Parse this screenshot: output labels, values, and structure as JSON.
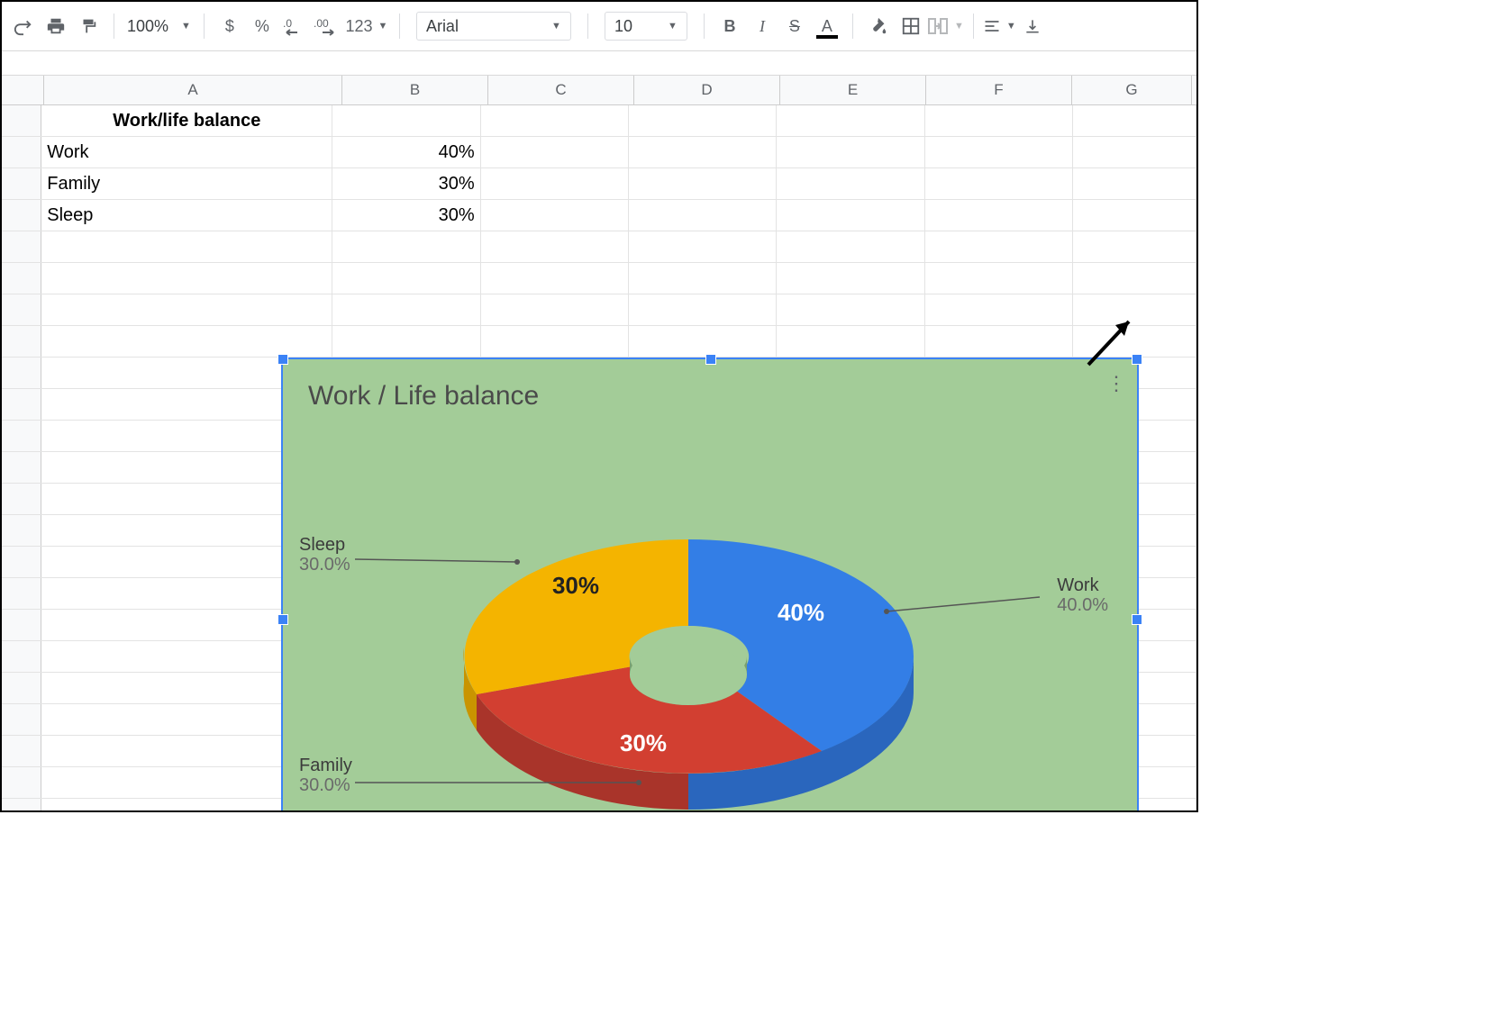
{
  "toolbar": {
    "zoom": "100%",
    "font": "Arial",
    "size": "10",
    "format123": "123"
  },
  "columns": [
    "A",
    "B",
    "C",
    "D",
    "E",
    "F",
    "G"
  ],
  "cells": {
    "a1": "Work/life balance",
    "a2": "Work",
    "b2": "40%",
    "a3": "Family",
    "b3": "30%",
    "a4": "Sleep",
    "b4": "30%"
  },
  "chart": {
    "title": "Work / Life balance",
    "labels": {
      "work": {
        "name": "Work",
        "pct": "40.0%",
        "slice": "40%"
      },
      "family": {
        "name": "Family",
        "pct": "30.0%",
        "slice": "30%"
      },
      "sleep": {
        "name": "Sleep",
        "pct": "30.0%",
        "slice": "30%"
      }
    }
  },
  "chart_data": {
    "type": "pie",
    "title": "Work / Life balance",
    "categories": [
      "Work",
      "Family",
      "Sleep"
    ],
    "values": [
      40,
      30,
      30
    ],
    "colors": [
      "#337ee6",
      "#d23f31",
      "#f4b400"
    ],
    "hole": 0.3,
    "is_3d": true
  }
}
